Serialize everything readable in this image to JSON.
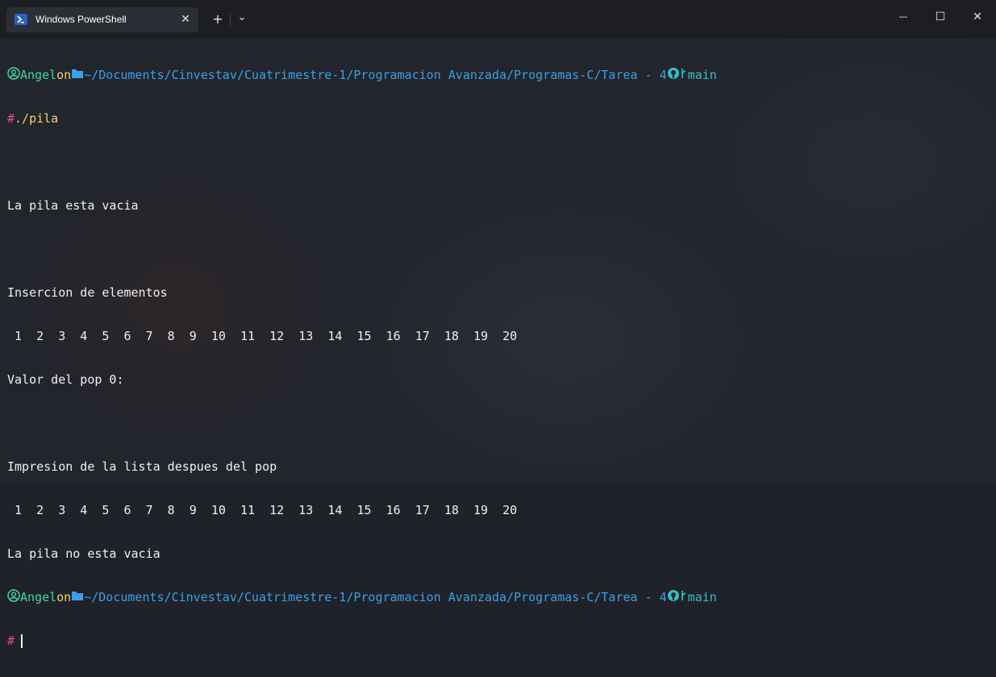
{
  "window": {
    "tab_title": "Windows PowerShell",
    "tab_close": "✕",
    "new_tab": "+",
    "dropdown": "⌄",
    "minimize": "—",
    "maximize": "☐",
    "close": "✕"
  },
  "prompt": {
    "user": "Angel",
    "on": "on",
    "path": "~/Documents/Cinvestav/Cuatrimestre-1/Programacion Avanzada/Programas-C/Tarea - 4",
    "branch": "main",
    "symbol": "#"
  },
  "command": "./pila",
  "output": {
    "empty_msg": "La pila esta vacia",
    "insert_header": "Insercion de elementos",
    "numbers": " 1  2  3  4  5  6  7  8  9  10  11  12  13  14  15  16  17  18  19  20",
    "pop_msg": "Valor del pop 0:",
    "after_pop_header": "Impresion de la lista despues del pop",
    "numbers_after": " 1  2  3  4  5  6  7  8  9  10  11  12  13  14  15  16  17  18  19  20",
    "not_empty_msg": "La pila no esta vacia"
  },
  "colors": {
    "user": "#3ed8a0",
    "path": "#3aa0e8",
    "branch": "#2fc2c8",
    "prompt_symbol": "#e0508a",
    "command": "#f2d16b"
  }
}
